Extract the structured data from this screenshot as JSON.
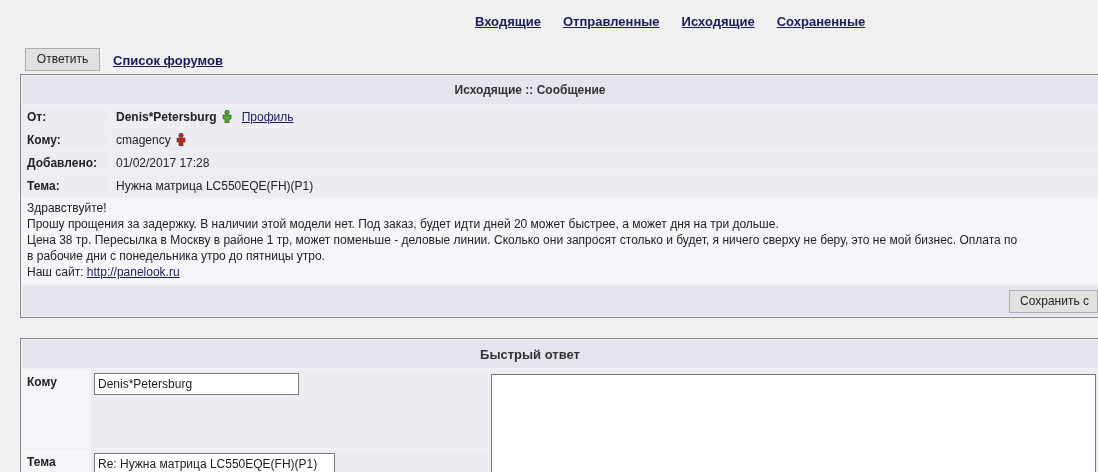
{
  "nav": [
    {
      "label": "Входящие"
    },
    {
      "label": "Отправленные"
    },
    {
      "label": "Исходящие"
    },
    {
      "label": "Сохраненные"
    }
  ],
  "toolbar": {
    "reply_button": "Ответить",
    "forums_link": "Список форумов"
  },
  "message": {
    "title": "Исходящие :: Сообщение",
    "fields": [
      {
        "label": "От:",
        "value": "Denis*Petersburg",
        "bold": true,
        "online": true,
        "link": "Профиль"
      },
      {
        "label": "Кому:",
        "value": "cmagency",
        "bold": false,
        "online": false
      },
      {
        "label": "Добавлено:",
        "value": "01/02/2017 17:28",
        "bold": false
      },
      {
        "label": "Тема:",
        "value": "Нужна матрица LC550EQE(FH)(P1)",
        "bold": false
      }
    ],
    "body_lines": [
      "Здравствуйте!",
      "Прошу прощения за задержку. В наличии этой модели нет. Под заказ, будет идти дней 20 может быстрее, а может дня на три дольше.",
      "Цена 38 тр. Пересылка в Москву в районе 1 тр, может поменьше - деловые линии. Сколько они запросят столько и будет, я ничего сверху не беру, это не мой бизнес. Оплата по",
      "в рабочие дни с понедельника утро до пятницы утро."
    ],
    "site_label": "Наш сайт:",
    "site_link": "http://panelook.ru",
    "save_button": "Сохранить с"
  },
  "quick_reply": {
    "title": "Быстрый ответ",
    "fields": [
      {
        "label": "Кому",
        "value": "Denis*Petersburg"
      },
      {
        "label": "Тема",
        "value": "Re: Нужна матрица LC550EQE(FH)(P1)"
      }
    ]
  }
}
